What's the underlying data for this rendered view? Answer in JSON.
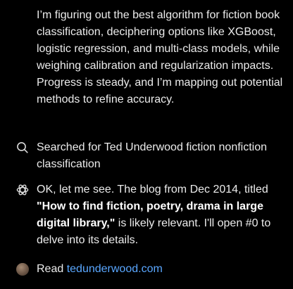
{
  "reasoning": {
    "paragraph": "I’m figuring out the best algorithm for fiction book classification, deciphering options like XGBoost, logistic regression, and multi-class models, while weighing calibration and regularization impacts. Progress is steady, and I’m mapping out potential methods to refine accuracy."
  },
  "search_step": {
    "icon": "search-icon",
    "text": "Searched for Ted Underwood fiction nonfiction classification"
  },
  "ok_step": {
    "icon": "openai-logo-icon",
    "text_before": "OK, let me see. The blog from Dec 2014, titled ",
    "bold_title": "\"How to find fiction, poetry, drama in large digital library,\"",
    "text_after": " is likely relevant. I'll open #0 to delve into its details."
  },
  "read_step": {
    "icon": "site-favicon-icon",
    "label": "Read ",
    "link": "tedunderwood.com",
    "link_color": "#5aa7ff"
  }
}
